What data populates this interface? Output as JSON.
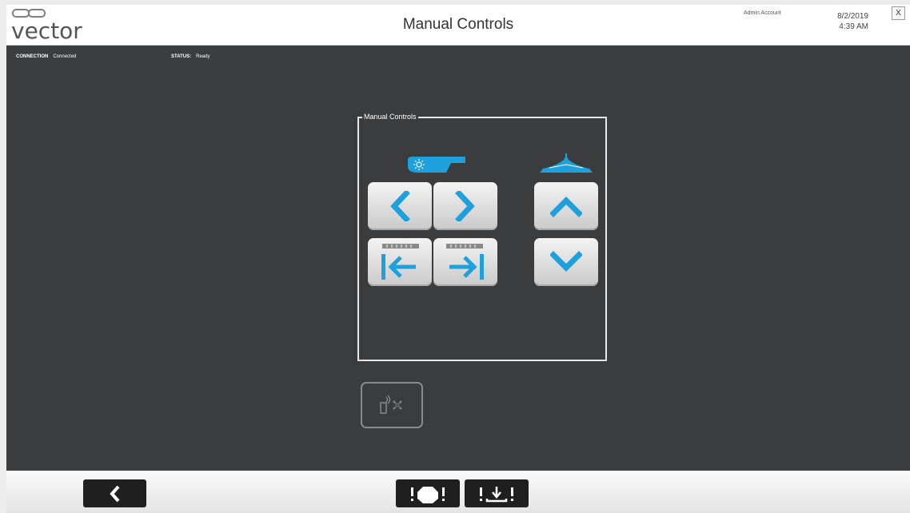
{
  "header": {
    "logo_text": "vector",
    "title": "Manual Controls",
    "account": "Admin Account",
    "date": "8/2/2019",
    "time": "4:39 AM",
    "close_label": "X"
  },
  "status_bar": {
    "connection_label": "CONNECTION",
    "connection_value": "Connected",
    "status_label": "STATUS:",
    "status_value": "Ready"
  },
  "panel": {
    "legend": "Manual Controls",
    "left_group_icon": "spray-nozzle-icon",
    "right_group_icon": "boom-icon",
    "buttons": [
      {
        "icon": "chevron-left-icon"
      },
      {
        "icon": "chevron-right-icon"
      },
      {
        "icon": "move-left-to-limit-icon"
      },
      {
        "icon": "move-right-to-limit-icon"
      },
      {
        "icon": "chevron-up-icon"
      },
      {
        "icon": "chevron-down-icon"
      }
    ],
    "remote_button_icon": "remote-disconnect-icon"
  },
  "footer": {
    "back_icon": "chevron-left-icon",
    "stop_icon": "emergency-stop-icon",
    "park_icon": "park-icon"
  },
  "colors": {
    "accent": "#1ea0dc",
    "main_bg": "#3b3c3e",
    "button_dark": "#1f1f1f"
  }
}
